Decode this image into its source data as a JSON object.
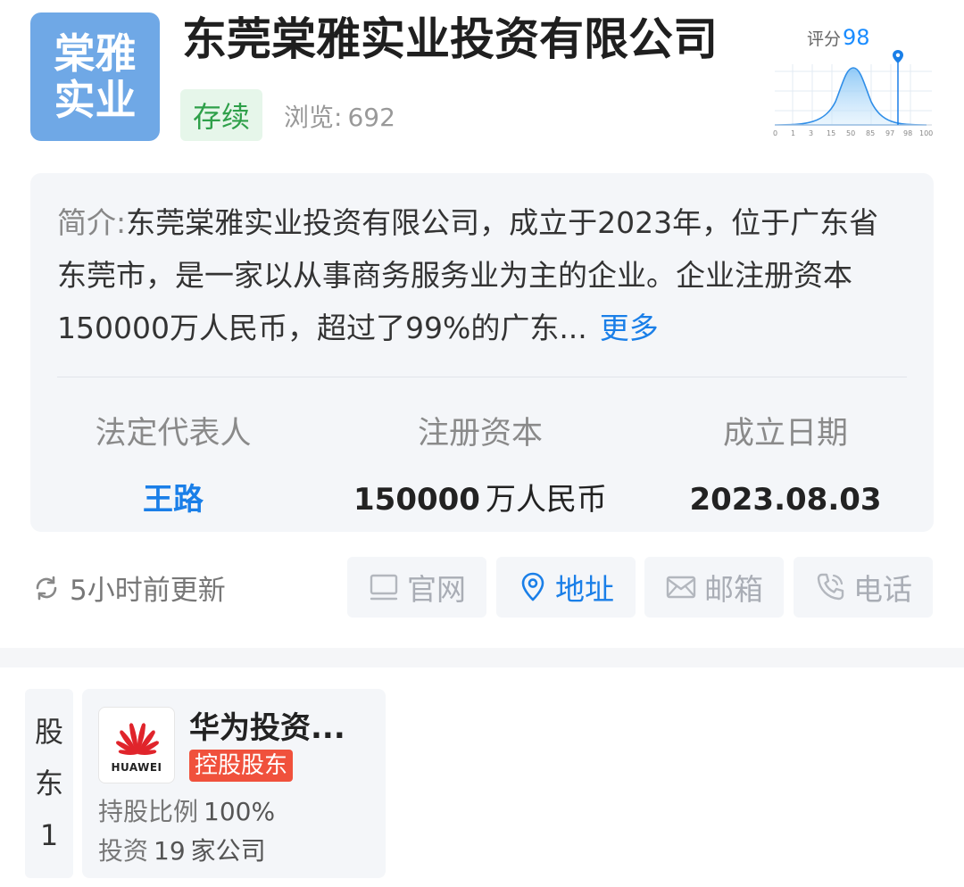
{
  "company": {
    "logo_line1": "棠雅",
    "logo_line2": "实业",
    "name": "东莞棠雅实业投资有限公司",
    "status": "存续",
    "views_label": "浏览:",
    "views_count": "692"
  },
  "score": {
    "label": "评分",
    "value": "98",
    "axis_ticks": [
      "0",
      "1",
      "3",
      "15",
      "50",
      "85",
      "97",
      "98",
      "100"
    ]
  },
  "intro": {
    "label": "简介:",
    "text": "东莞棠雅实业投资有限公司，成立于2023年，位于广东省东莞市，是一家以从事商务服务业为主的企业。企业注册资本150000万人民币，超过了99%的广东...",
    "more": "更多"
  },
  "info": {
    "legal_rep_label": "法定代表人",
    "legal_rep_value": "王路",
    "capital_label": "注册资本",
    "capital_value": "150000",
    "capital_unit": "万人民币",
    "date_label": "成立日期",
    "date_value": "2023.08.03"
  },
  "update": {
    "text": "5小时前更新"
  },
  "actions": {
    "website": "官网",
    "address": "地址",
    "email": "邮箱",
    "phone": "电话"
  },
  "shareholder": {
    "tab_chars": [
      "股",
      "东",
      "1"
    ],
    "logo_text": "HUAWEI",
    "name": "华为投资...",
    "badge": "控股股东",
    "ratio_label": "持股比例",
    "ratio_value": "100%",
    "invest_label": "投资",
    "invest_count": "19",
    "invest_unit": "家公司"
  },
  "colors": {
    "accent_blue": "#1a7fe8",
    "status_green": "#2fa04a",
    "badge_red": "#f0513c",
    "logo_blue": "#6fa8e6"
  }
}
